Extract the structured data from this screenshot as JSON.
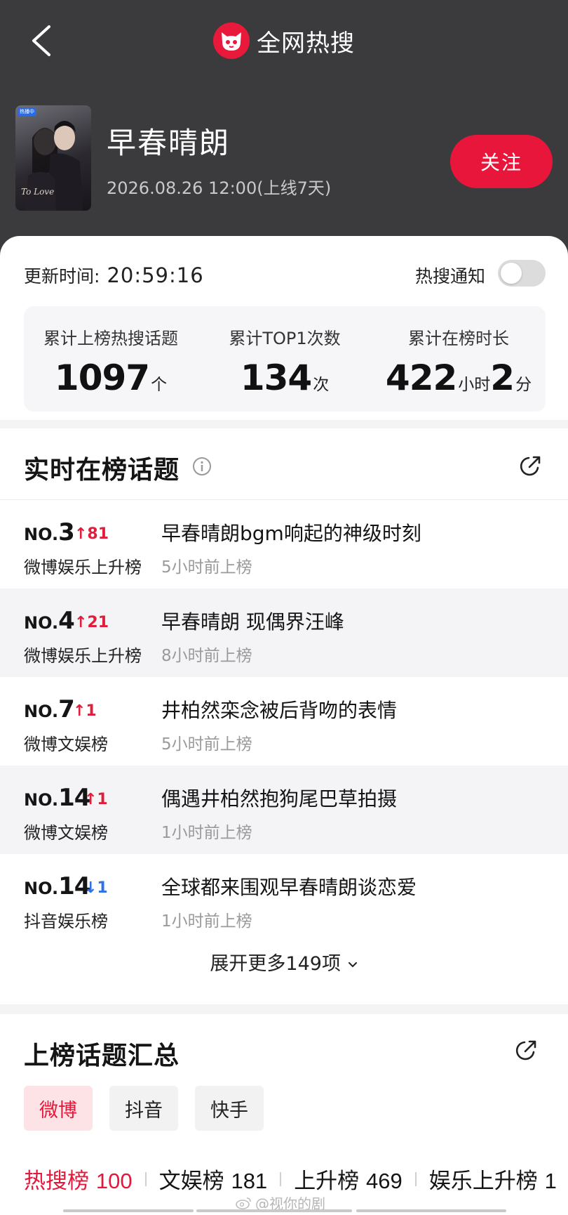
{
  "header": {
    "app_title": "全网热搜",
    "logo_icon": "cat-logo-icon",
    "back_icon": "chevron-left-icon"
  },
  "show": {
    "title": "早春晴朗",
    "date": "2026.08.26 12:00(上线7天)",
    "follow_label": "关注",
    "poster_tag": "热播中",
    "poster_text": "To Love"
  },
  "stats": {
    "update_label": "更新时间:",
    "update_time": "20:59:16",
    "notify_label": "热搜通知",
    "notify_on": false,
    "items": [
      {
        "label": "累计上榜热搜话题",
        "value": "1097",
        "unit": "个"
      },
      {
        "label": "累计TOP1次数",
        "value": "134",
        "unit": "次"
      },
      {
        "label": "累计在榜时长",
        "value": "422",
        "unit": "小时",
        "value2": "2",
        "unit2": "分"
      }
    ]
  },
  "realtime": {
    "title": "实时在榜话题",
    "topics": [
      {
        "no": "NO.",
        "rank": "3",
        "trend": "↑81",
        "dir": "up",
        "board": "微博娱乐上升榜",
        "title": "早春晴朗bgm响起的神级时刻",
        "time": "5小时前上榜"
      },
      {
        "no": "NO.",
        "rank": "4",
        "trend": "↑21",
        "dir": "up",
        "board": "微博娱乐上升榜",
        "title": "早春晴朗 现偶界汪峰",
        "time": "8小时前上榜"
      },
      {
        "no": "NO.",
        "rank": "7",
        "trend": "↑1",
        "dir": "up",
        "board": "微博文娱榜",
        "title": "井柏然栾念被后背吻的表情",
        "time": "5小时前上榜"
      },
      {
        "no": "NO.",
        "rank": "14",
        "trend": "↑1",
        "dir": "up",
        "board": "微博文娱榜",
        "title": "偶遇井柏然抱狗尾巴草拍摄",
        "time": "1小时前上榜"
      },
      {
        "no": "NO.",
        "rank": "14",
        "trend": "↓1",
        "dir": "down",
        "board": "抖音娱乐榜",
        "title": "全球都来围观早春晴朗谈恋爱",
        "time": "1小时前上榜"
      }
    ],
    "expand_label": "展开更多149项",
    "expand_icon": "chevron-down-icon"
  },
  "summary": {
    "title": "上榜话题汇总",
    "platforms": [
      "微博",
      "抖音",
      "快手"
    ],
    "active_platform": 0,
    "boards": [
      {
        "label": "热搜榜",
        "count": "100"
      },
      {
        "label": "文娱榜",
        "count": "181"
      },
      {
        "label": "上升榜",
        "count": "469"
      },
      {
        "label": "娱乐上升榜",
        "count": "1"
      }
    ]
  },
  "watermark": "@视你的剧",
  "colors": {
    "accent": "#e8163a",
    "header_bg": "#3b3b3d",
    "up": "#e01e3c",
    "down": "#2c72e8"
  }
}
